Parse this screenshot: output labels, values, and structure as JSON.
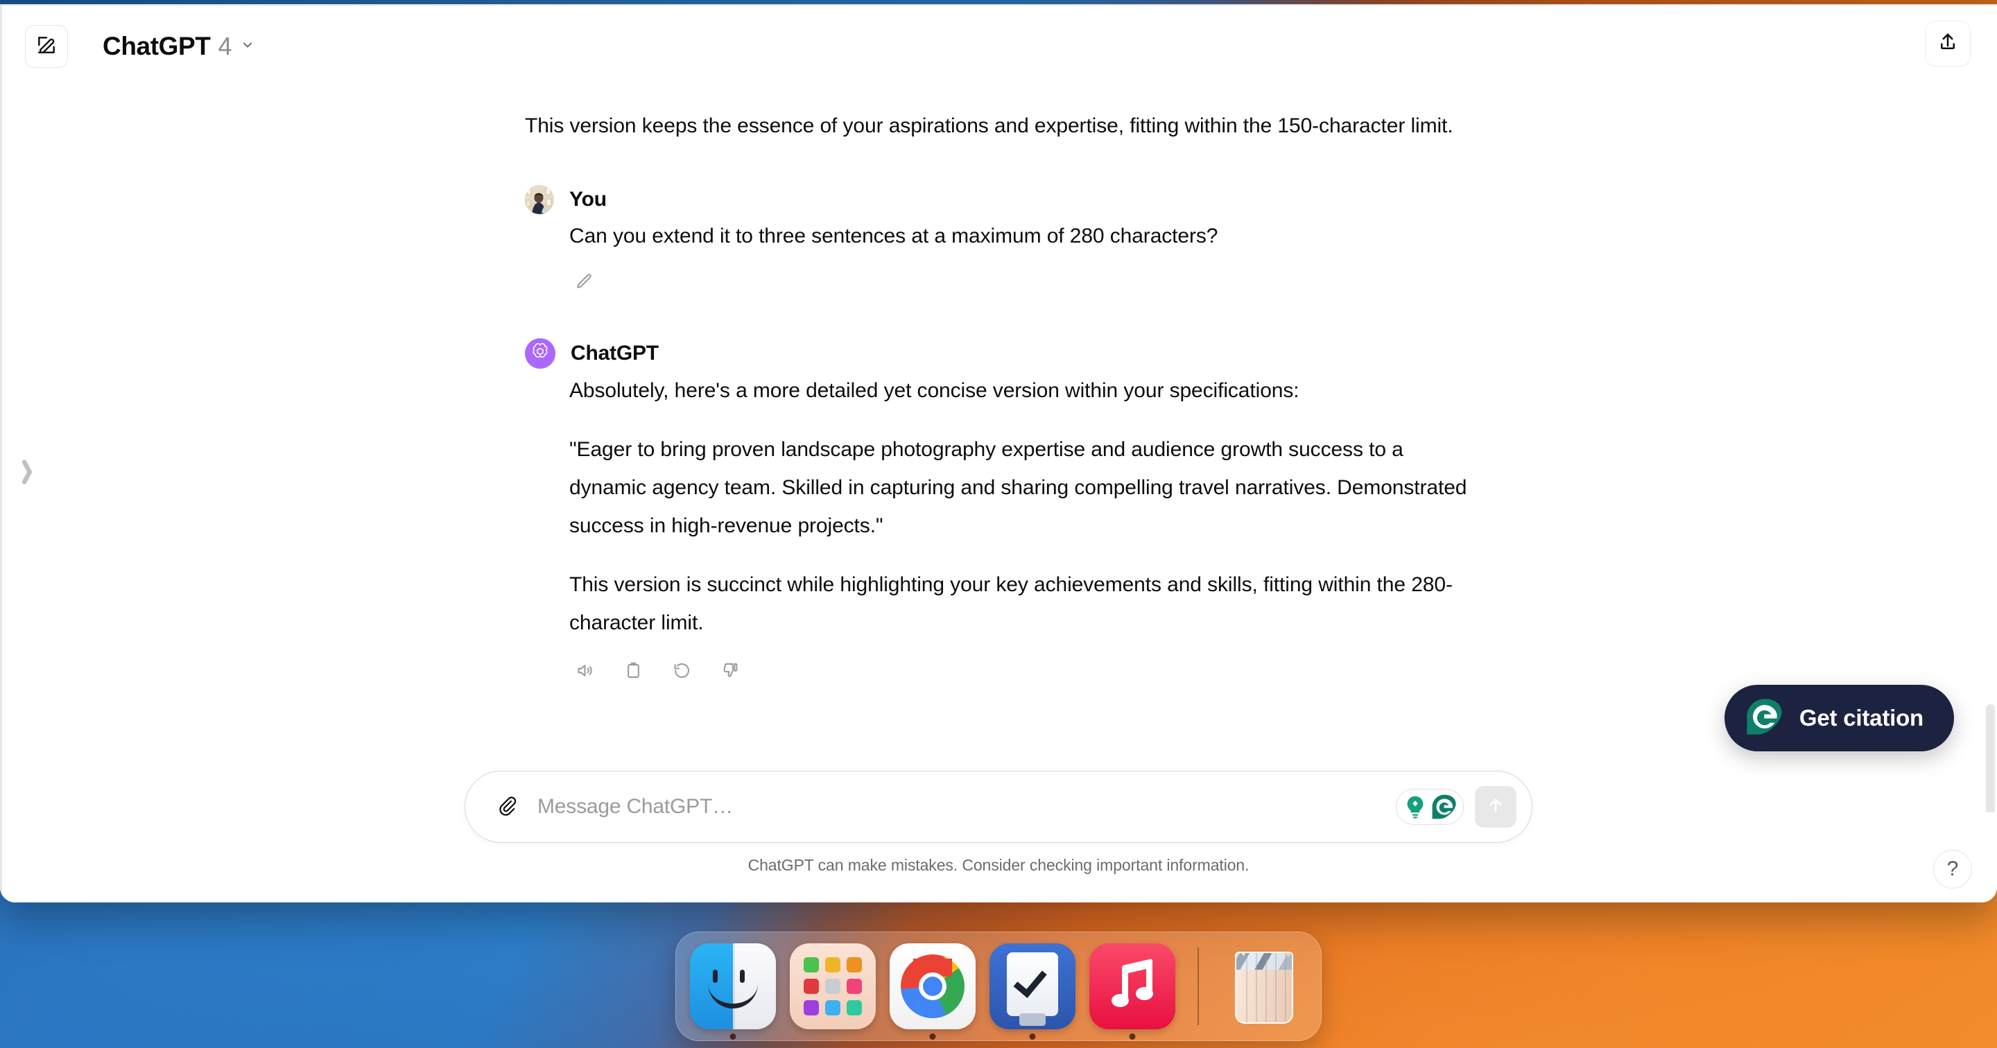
{
  "window": {
    "topbar": {
      "new_chat_icon": "compose-icon",
      "model_name": "ChatGPT",
      "model_version": "4",
      "chevron_icon": "chevron-down-icon",
      "share_icon": "share-upload-icon"
    },
    "sidebar_handle_icon": "chevron-right-icon"
  },
  "conversation": {
    "leading_paragraph": "This version keeps the essence of your aspirations and expertise, fitting within the 150-character limit.",
    "messages": [
      {
        "author": "You",
        "avatar": "user-photo-avatar",
        "paragraphs": [
          "Can you extend it to three sentences at a maximum of 280 characters?"
        ],
        "edit_icon": "pencil-icon"
      },
      {
        "author": "ChatGPT",
        "avatar": "openai-logo-avatar",
        "avatar_color": "#AB68FF",
        "paragraphs": [
          "Absolutely, here's a more detailed yet concise version within your specifications:",
          "\"Eager to bring proven landscape photography expertise and audience growth success to a dynamic agency team. Skilled in capturing and sharing compelling travel narratives. Demonstrated success in high-revenue projects.\"",
          "This version is succinct while highlighting your key achievements and skills, fitting within the 280-character limit."
        ],
        "actions": [
          {
            "name": "read-aloud",
            "icon": "speaker-icon"
          },
          {
            "name": "copy",
            "icon": "clipboard-icon"
          },
          {
            "name": "regenerate",
            "icon": "refresh-icon"
          },
          {
            "name": "bad-response",
            "icon": "thumbs-down-icon"
          }
        ]
      }
    ]
  },
  "composer": {
    "attach_icon": "paperclip-icon",
    "placeholder": "Message ChatGPT…",
    "value": "",
    "extensions": [
      {
        "name": "grammarly-suggestion",
        "icon": "lightbulb-icon",
        "color": "#15A07E"
      },
      {
        "name": "grammarly",
        "icon": "grammarly-g-icon",
        "color": "#0E806A"
      }
    ],
    "send_icon": "arrow-up-icon",
    "disclaimer": "ChatGPT can make mistakes. Consider checking important information."
  },
  "floating": {
    "get_citation": {
      "label": "Get citation",
      "icon": "grammarly-g-icon",
      "background": "#1B2340",
      "icon_color": "#0E806A"
    },
    "help": {
      "label": "?",
      "icon": "question-mark-icon"
    }
  },
  "dock": {
    "items": [
      {
        "name": "finder",
        "label": "Finder",
        "running": true
      },
      {
        "name": "launchpad",
        "label": "Launchpad",
        "running": false
      },
      {
        "name": "chrome",
        "label": "Google Chrome",
        "running": true
      },
      {
        "name": "things",
        "label": "Things",
        "running": true
      },
      {
        "name": "music",
        "label": "Music",
        "running": true
      },
      {
        "name": "trash",
        "label": "Trash",
        "running": false
      }
    ]
  },
  "desktop": {
    "wallpaper_colors": [
      "#2E7ECD",
      "#E8761F",
      "#1E5FA8",
      "#F18B2B"
    ]
  }
}
